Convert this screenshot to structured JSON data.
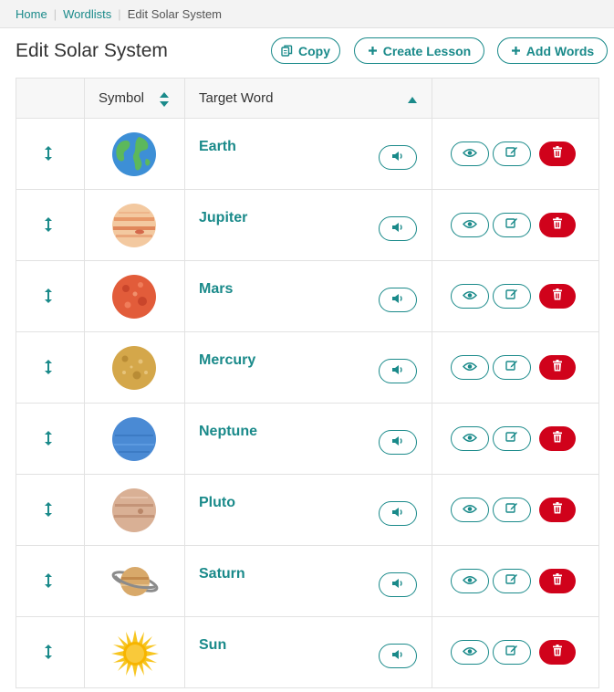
{
  "breadcrumb": {
    "items": [
      {
        "label": "Home"
      },
      {
        "label": "Wordlists"
      },
      {
        "label": "Edit Solar System"
      }
    ]
  },
  "page": {
    "title": "Edit Solar System"
  },
  "header_buttons": {
    "copy_label": "Copy",
    "create_lesson_label": "Create Lesson",
    "add_words_label": "Add Words"
  },
  "table": {
    "columns": [
      "",
      "Symbol",
      "Target Word",
      ""
    ],
    "sort": {
      "column": "Target Word",
      "direction": "ascending"
    },
    "rows": [
      {
        "word": "Earth",
        "symbol": "earth-planet-icon"
      },
      {
        "word": "Jupiter",
        "symbol": "jupiter-planet-icon"
      },
      {
        "word": "Mars",
        "symbol": "mars-planet-icon"
      },
      {
        "word": "Mercury",
        "symbol": "mercury-planet-icon"
      },
      {
        "word": "Neptune",
        "symbol": "neptune-planet-icon"
      },
      {
        "word": "Pluto",
        "symbol": "pluto-planet-icon"
      },
      {
        "word": "Saturn",
        "symbol": "saturn-planet-icon"
      },
      {
        "word": "Sun",
        "symbol": "sun-icon"
      }
    ]
  },
  "colors": {
    "accent": "#1a8a8a",
    "danger": "#d0021b",
    "header_bg": "#f7f7f7",
    "border": "#e2e2e2"
  }
}
